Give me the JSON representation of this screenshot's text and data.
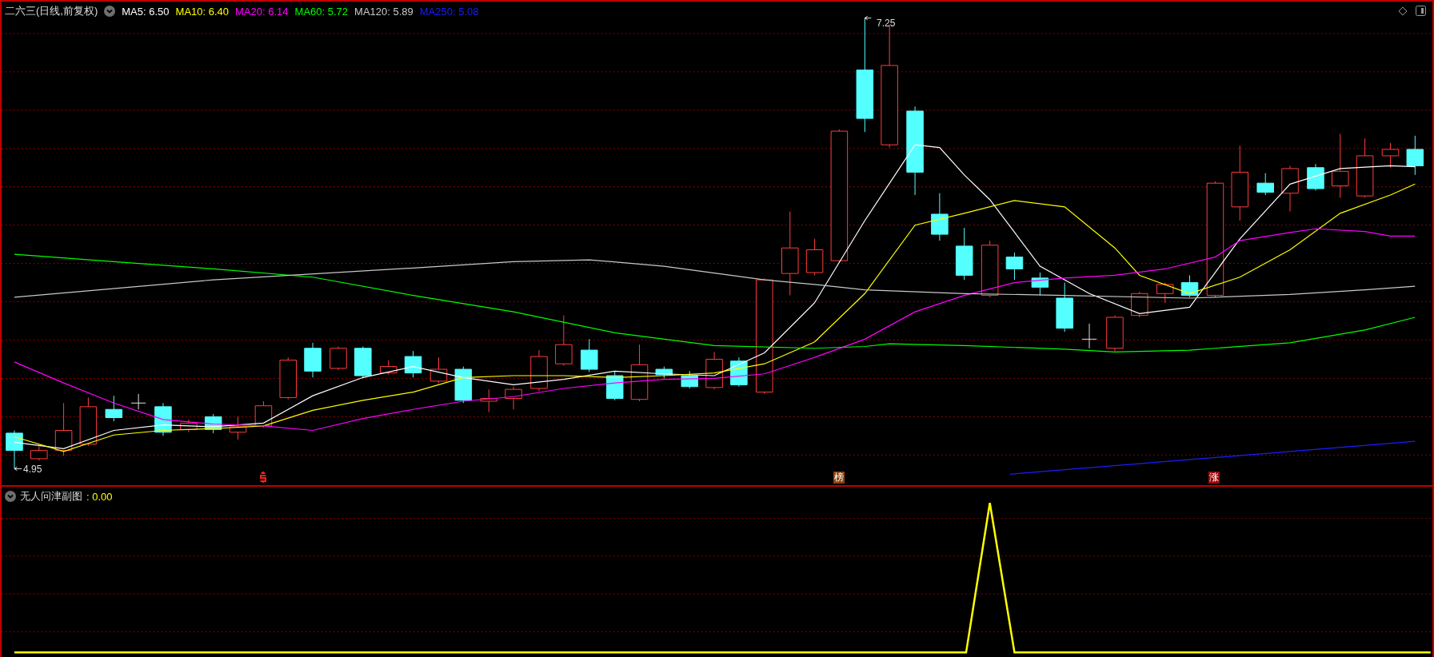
{
  "main_chart": {
    "title": "二六三(日线,前复权)",
    "indicators": [
      {
        "label": "MA5: 6.50",
        "color": "#ffffff"
      },
      {
        "label": "MA10: 6.40",
        "color": "#ffff00"
      },
      {
        "label": "MA20: 6.14",
        "color": "#ff00ff"
      },
      {
        "label": "MA60: 5.72",
        "color": "#00ff00"
      },
      {
        "label": "MA120: 5.89",
        "color": "#c8c8c8"
      },
      {
        "label": "MA250: 5.08",
        "color": "#1c1cff"
      }
    ],
    "high_label": "7.25",
    "low_label": "4.95",
    "signal_marks": [
      {
        "kind": "dollar",
        "color": "#ff1e1e"
      },
      {
        "kind": "badge",
        "label": "榜",
        "color": "#8a4510"
      },
      {
        "kind": "badge",
        "label": "涨",
        "color": "#9a0a0a"
      }
    ]
  },
  "sub_chart": {
    "title": "无人问津副图",
    "value": ": 0.00"
  }
}
